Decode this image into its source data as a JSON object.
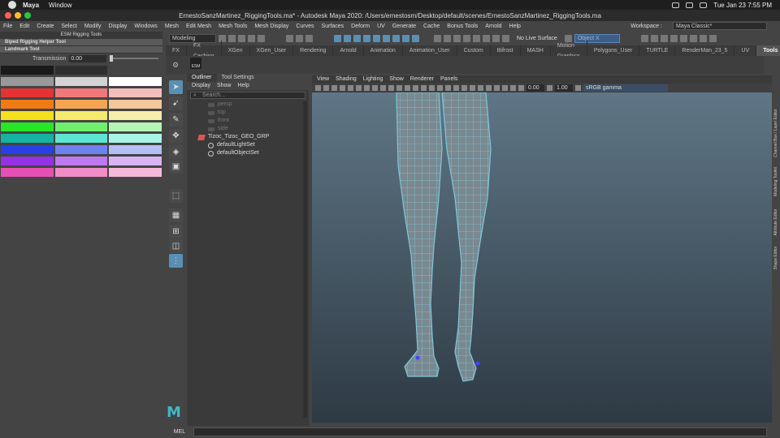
{
  "mac_menu": {
    "app": "Maya",
    "window": "Window",
    "clock": "Tue Jan 23  7:55 PM"
  },
  "window_title": "ErnestoSanzMartinez_RiggingTools.ma* - Autodesk Maya 2020: /Users/ernestosm/Desktop/default/scenes/ErnestoSanzMartinez_RiggingTools.ma",
  "menus": [
    "File",
    "Edit",
    "Create",
    "Select",
    "Modify",
    "Display",
    "Windows",
    "Mesh",
    "Edit Mesh",
    "Mesh Tools",
    "Mesh Display",
    "Curves",
    "Surfaces",
    "Deform",
    "UV",
    "Generate",
    "Cache",
    "Bonus Tools",
    "Arnold",
    "Help"
  ],
  "workspace": {
    "label": "Workspace :",
    "value": "Maya Classic*"
  },
  "statusline": {
    "mode": "Modeling",
    "live": "No Live Surface",
    "object_field": "Object X"
  },
  "shelf_tabs": [
    "FX",
    "FX Caching",
    "XGen",
    "XGen_User",
    "Rendering",
    "Arnold",
    "Animation",
    "Animation_User",
    "Custom",
    "Bifrost",
    "MASH",
    "Motion Graphics",
    "Polygons_User",
    "TURTLE",
    "RenderMan_23_5",
    "UV",
    "Tools"
  ],
  "shelf_icon_label": "ESM",
  "esm": {
    "title": "ESM Rigging Tools",
    "sections": [
      "Biped Rigging Helper Tool",
      "Landmark Tool"
    ],
    "transmission_label": "Transmission",
    "transmission_value": "0.00",
    "transmission_level": 0.0,
    "swatches": [
      [
        "#1a1a1a",
        "#2e2e2e",
        "#444444"
      ],
      [
        "#999999",
        "#d3d3d3",
        "#ffffff"
      ],
      [
        "#e63232",
        "#f07878",
        "#f5bcbc"
      ],
      [
        "#f07a14",
        "#f5a552",
        "#f5c79c"
      ],
      [
        "#f5e020",
        "#f5ea6e",
        "#f5eeaa"
      ],
      [
        "#28e628",
        "#6ef06e",
        "#b4f5b4"
      ],
      [
        "#14b4a0",
        "#5ae6d2",
        "#a8f5e8"
      ],
      [
        "#2840e6",
        "#6e82f0",
        "#b4c0f5"
      ],
      [
        "#9632e6",
        "#be78f0",
        "#d8b4f5"
      ],
      [
        "#e650b4",
        "#f08cc8",
        "#f5b9dc"
      ]
    ]
  },
  "outliner": {
    "tabs": [
      "Outliner",
      "Tool Settings"
    ],
    "menu": [
      "Display",
      "Show",
      "Help"
    ],
    "search_placeholder": "Search...",
    "items": [
      {
        "label": "persp",
        "type": "camera",
        "dim": true
      },
      {
        "label": "top",
        "type": "camera",
        "dim": true
      },
      {
        "label": "front",
        "type": "camera",
        "dim": true
      },
      {
        "label": "side",
        "type": "camera",
        "dim": true
      },
      {
        "label": "Tizoc_Tizoc_GEO_GRP",
        "type": "group",
        "dim": false
      },
      {
        "label": "defaultLightSet",
        "type": "set",
        "dim": false
      },
      {
        "label": "defaultObjectSet",
        "type": "set",
        "dim": false
      }
    ]
  },
  "viewport": {
    "menu": [
      "View",
      "Shading",
      "Lighting",
      "Show",
      "Renderer",
      "Panels"
    ],
    "exposure": "0.00",
    "gamma": "1.00",
    "colorspace": "sRGB gamma",
    "mesh_color": "#7ec8d8"
  },
  "right_tabs": [
    "Channel Box / Layer Editor",
    "Modeling Toolkit",
    "Attribute Editor",
    "Shape Editor"
  ],
  "mel_label": "MEL"
}
